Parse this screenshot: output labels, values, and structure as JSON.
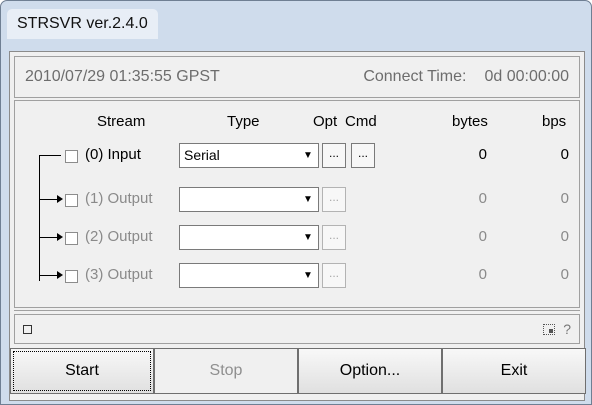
{
  "window": {
    "title": "STRSVR ver.2.4.0"
  },
  "status": {
    "datetime": "2010/07/29 01:35:55 GPST",
    "connect_label": "Connect Time:",
    "connect_time": "0d 00:00:00"
  },
  "headers": {
    "stream": "Stream",
    "type": "Type",
    "opt": "Opt",
    "cmd": "Cmd",
    "bytes": "bytes",
    "bps": "bps"
  },
  "rows": [
    {
      "label": "(0) Input",
      "type": "Serial",
      "bytes": "0",
      "bps": "0",
      "opt_label": "...",
      "cmd_label": "..."
    },
    {
      "label": "(1) Output",
      "type": "",
      "bytes": "0",
      "bps": "0",
      "opt_label": "..."
    },
    {
      "label": "(2) Output",
      "type": "",
      "bytes": "0",
      "bps": "0",
      "opt_label": "..."
    },
    {
      "label": "(3) Output",
      "type": "",
      "bytes": "0",
      "bps": "0",
      "opt_label": "..."
    }
  ],
  "bottom": {
    "help": "?"
  },
  "buttons": {
    "start": "Start",
    "stop": "Stop",
    "option": "Option...",
    "exit": "Exit"
  }
}
